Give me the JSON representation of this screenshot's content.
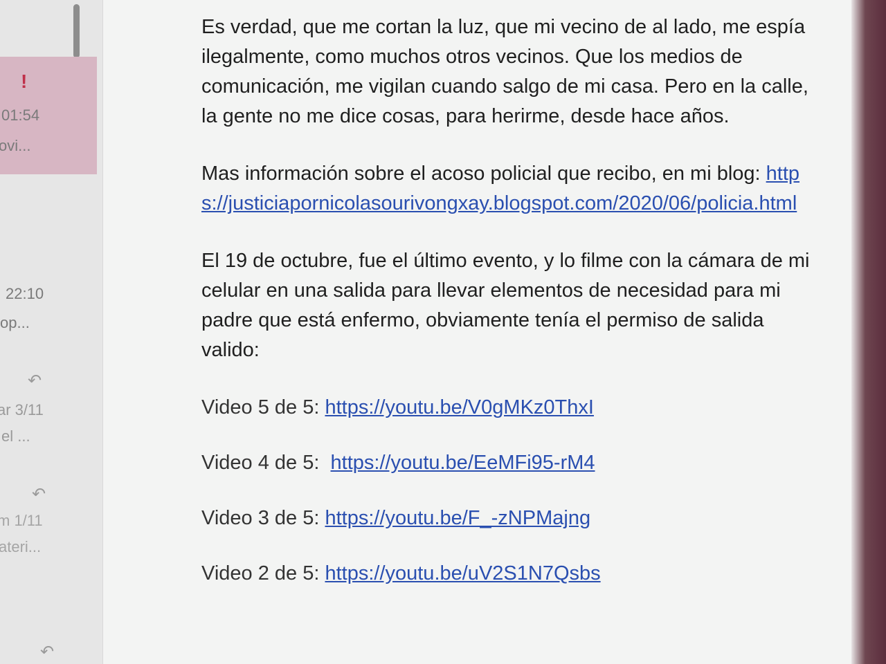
{
  "mail_list": {
    "items": [
      {
        "flag": "!",
        "time": "01:54",
        "snippet": "ovi...",
        "selected": true
      },
      {
        "time": "22:10",
        "snippet": "op..."
      },
      {
        "time": "ar 3/11",
        "snippet": "el ..."
      },
      {
        "time": "m 1/11",
        "snippet": "ateri..."
      }
    ]
  },
  "message": {
    "paragraph1": "Es verdad, que me cortan la luz, que mi vecino de al lado, me espía ilegalmente, como muchos otros vecinos. Que los medios de comunicación, me vigilan cuando salgo de mi casa. Pero en la calle, la gente no me dice cosas, para herirme, desde hace años.",
    "paragraph2_text": "Mas información sobre el acoso policial que recibo,  en mi blog: ",
    "paragraph2_link": "https://justiciapornicolasourivongxay.blogspot.com/2020/06/policia.html",
    "paragraph3": "El 19 de octubre, fue el último evento, y lo filme con la cámara de mi celular en una salida para llevar elementos de necesidad para mi padre que está enfermo, obviamente tenía el permiso de salida valido:",
    "videos": [
      {
        "label": "Video 5 de 5: ",
        "url": "https://youtu.be/V0gMKz0ThxI"
      },
      {
        "label": "Video 4 de 5:  ",
        "url": "https://youtu.be/EeMFi95-rM4"
      },
      {
        "label": "Video 3 de 5: ",
        "url": "https://youtu.be/F_-zNPMajng"
      },
      {
        "label": "Video 2 de 5: ",
        "url": "https://youtu.be/uV2S1N7Qsbs"
      }
    ]
  },
  "colors": {
    "link": "#2a4fb0",
    "selected_item": "#d7b6c3",
    "flag": "#c0304a"
  }
}
